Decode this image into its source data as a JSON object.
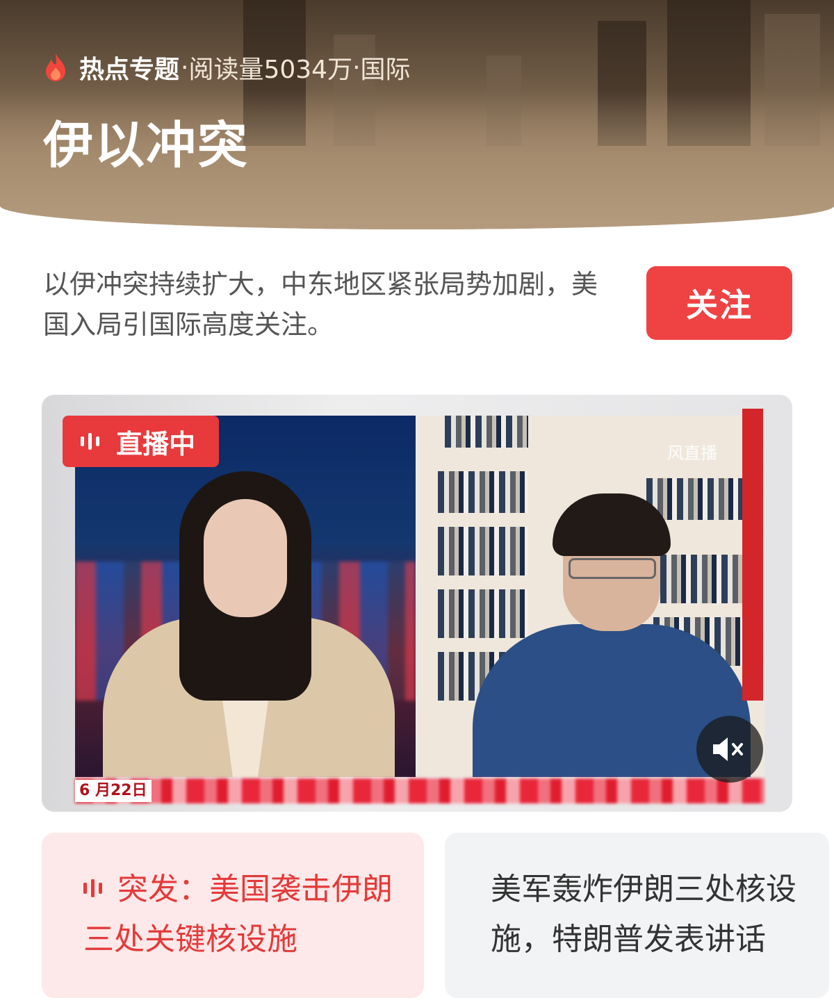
{
  "header": {
    "hot_label": "热点专题",
    "separator": "·",
    "read_count": "阅读量5034万",
    "category": "国际",
    "title": "伊以冲突"
  },
  "summary": {
    "text": "以伊冲突持续扩大，中东地区紧张局势加剧，美国入局引国际高度关注。",
    "follow_label": "关注"
  },
  "video": {
    "live_label": "直播中",
    "date_label": "6 月22日",
    "watermark": "风直播",
    "icons": [
      "live-bars-icon",
      "mute-icon"
    ]
  },
  "cards": [
    {
      "text": "突发：美国袭击伊朗三处关键核设施",
      "is_live": true
    },
    {
      "text": "美军轰炸伊朗三处核设施，特朗普发表讲话",
      "is_live": false
    }
  ],
  "colors": {
    "accent": "#ef4343",
    "live_card_bg": "#fde9e9",
    "card_bg": "#f2f3f5"
  }
}
